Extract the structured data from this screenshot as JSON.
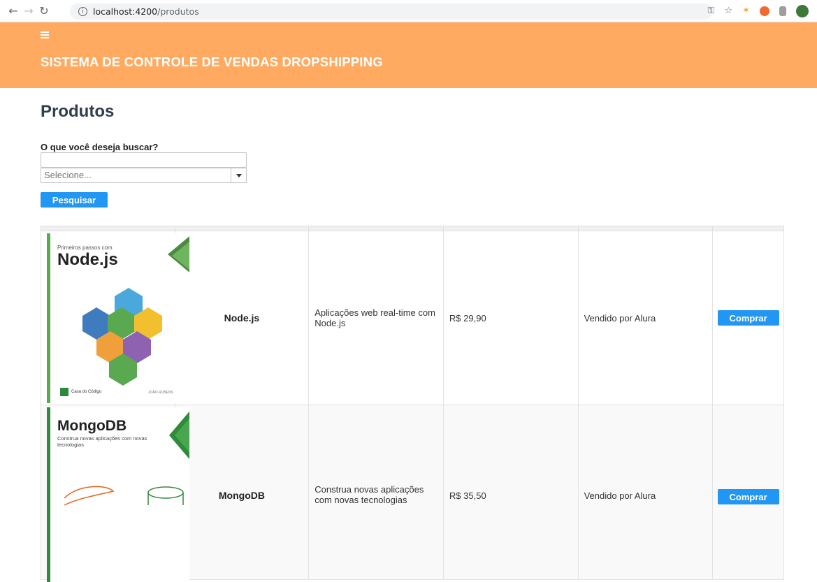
{
  "browser": {
    "url_host": "localhost:4200",
    "url_path": "/produtos"
  },
  "app": {
    "title": "SISTEMA DE CONTROLE DE VENDAS DROPSHIPPING",
    "header_color": "#ffaa60"
  },
  "page": {
    "title": "Produtos"
  },
  "search": {
    "label": "O que você deseja buscar?",
    "input_value": "",
    "select_placeholder": "Selecione...",
    "button_label": "Pesquisar"
  },
  "products": [
    {
      "name": "Node.js",
      "description": "Aplicações web real-time com Node.js",
      "price": "R$ 29,90",
      "vendor": "Vendido por Alura",
      "buy_label": "Comprar",
      "cover": {
        "top_sub": "Primeiros passos com",
        "title": "Node.js",
        "publisher": "Casa do Código",
        "author": "JOÃO RUBENS",
        "accent": "#5aa84f"
      }
    },
    {
      "name": "MongoDB",
      "description": "Construa novas aplicações com novas tecnologias",
      "price": "R$ 35,50",
      "vendor": "Vendido por Alura",
      "buy_label": "Comprar",
      "cover": {
        "title": "MongoDB",
        "subtitle": "Construa novas aplicações com novas tecnologias",
        "accent": "#2e8b3a"
      }
    }
  ]
}
